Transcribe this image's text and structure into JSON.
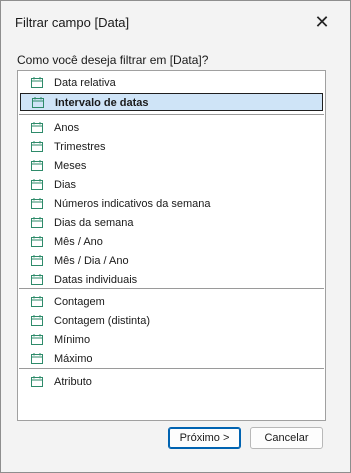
{
  "dialog": {
    "title": "Filtrar campo [Data]",
    "prompt": "Como você deseja filtrar em [Data]?",
    "close_symbol": "✕"
  },
  "list": {
    "group1": [
      {
        "label": "Data relativa",
        "icon": "calendar-icon",
        "selected": false
      },
      {
        "label": "Intervalo de datas",
        "icon": "calendar-icon",
        "selected": true
      }
    ],
    "group2": [
      {
        "label": "Anos",
        "icon": "calendar-icon"
      },
      {
        "label": "Trimestres",
        "icon": "calendar-icon"
      },
      {
        "label": "Meses",
        "icon": "calendar-icon"
      },
      {
        "label": "Dias",
        "icon": "calendar-icon"
      },
      {
        "label": "Números indicativos da semana",
        "icon": "calendar-icon"
      },
      {
        "label": "Dias da semana",
        "icon": "calendar-icon"
      },
      {
        "label": "Mês / Ano",
        "icon": "calendar-icon"
      },
      {
        "label": "Mês / Dia / Ano",
        "icon": "calendar-icon"
      },
      {
        "label": "Datas individuais",
        "icon": "calendar-icon"
      }
    ],
    "group3": [
      {
        "label": "Contagem",
        "icon": "calendar-icon"
      },
      {
        "label": "Contagem (distinta)",
        "icon": "calendar-icon"
      },
      {
        "label": "Mínimo",
        "icon": "calendar-icon"
      },
      {
        "label": "Máximo",
        "icon": "calendar-icon"
      }
    ],
    "group4": [
      {
        "label": "Atributo",
        "icon": "calendar-icon"
      }
    ]
  },
  "buttons": {
    "next_label": "Próximo >",
    "cancel_label": "Cancelar"
  },
  "colors": {
    "icon_green": "#2e8b6a",
    "selection_bg": "#cfe4f7"
  }
}
